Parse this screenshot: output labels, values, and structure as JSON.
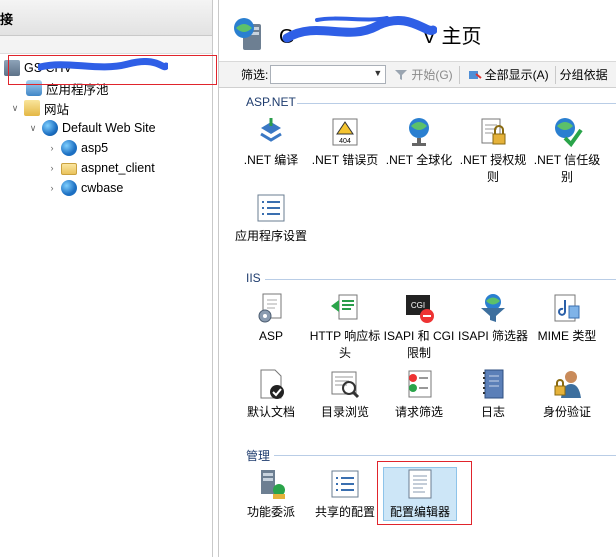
{
  "left_pane": {
    "header": "连接",
    "tree": [
      {
        "label": "GS          CHV",
        "icon": "server-icon",
        "level": 0,
        "expanded": true
      },
      {
        "label": "应用程序池",
        "icon": "app-pool-icon",
        "level": 1
      },
      {
        "label": "网站",
        "icon": "sites-folder-icon",
        "level": 1,
        "expanded": true
      },
      {
        "label": "Default Web Site",
        "icon": "website-globe-icon",
        "level": 2,
        "expanded": true
      },
      {
        "label": "asp5",
        "icon": "app-globe-icon",
        "level": 3
      },
      {
        "label": "aspnet_client",
        "icon": "folder-icon",
        "level": 3
      },
      {
        "label": "cwbase",
        "icon": "app-globe-icon",
        "level": 3
      }
    ]
  },
  "right_pane": {
    "title_prefix": "G",
    "title_suffix": "V 主页",
    "filter": {
      "label": "筛选:",
      "value": "",
      "start_label": "开始(G)",
      "show_all_label": "全部显示(A)",
      "group_by_label": "分组依据"
    },
    "sections": [
      {
        "name": "ASP.NET",
        "items": [
          {
            "label": ".NET 编译",
            "icon": "dotnet-compile-icon"
          },
          {
            "label": ".NET 错误页",
            "icon": "dotnet-error-page-icon"
          },
          {
            "label": ".NET 全球化",
            "icon": "dotnet-globalization-icon"
          },
          {
            "label": ".NET 授权规则",
            "icon": "dotnet-authorization-icon"
          },
          {
            "label": ".NET 信任级别",
            "icon": "dotnet-trust-level-icon"
          },
          {
            "label": "应用程序设置",
            "icon": "app-settings-icon"
          }
        ]
      },
      {
        "name": "IIS",
        "items": [
          {
            "label": "ASP",
            "icon": "asp-icon"
          },
          {
            "label": "HTTP 响应标头",
            "icon": "http-headers-icon"
          },
          {
            "label": "ISAPI 和 CGI 限制",
            "icon": "isapi-cgi-icon"
          },
          {
            "label": "ISAPI 筛选器",
            "icon": "isapi-filters-icon"
          },
          {
            "label": "MIME 类型",
            "icon": "mime-types-icon"
          },
          {
            "label": "默认文档",
            "icon": "default-document-icon"
          },
          {
            "label": "目录浏览",
            "icon": "directory-browsing-icon"
          },
          {
            "label": "请求筛选",
            "icon": "request-filtering-icon"
          },
          {
            "label": "日志",
            "icon": "logging-icon"
          },
          {
            "label": "身份验证",
            "icon": "authentication-icon"
          }
        ]
      },
      {
        "name": "管理",
        "items": [
          {
            "label": "功能委派",
            "icon": "feature-delegation-icon"
          },
          {
            "label": "共享的配置",
            "icon": "shared-config-icon"
          },
          {
            "label": "配置编辑器",
            "icon": "config-editor-icon",
            "selected": true
          }
        ]
      }
    ]
  }
}
